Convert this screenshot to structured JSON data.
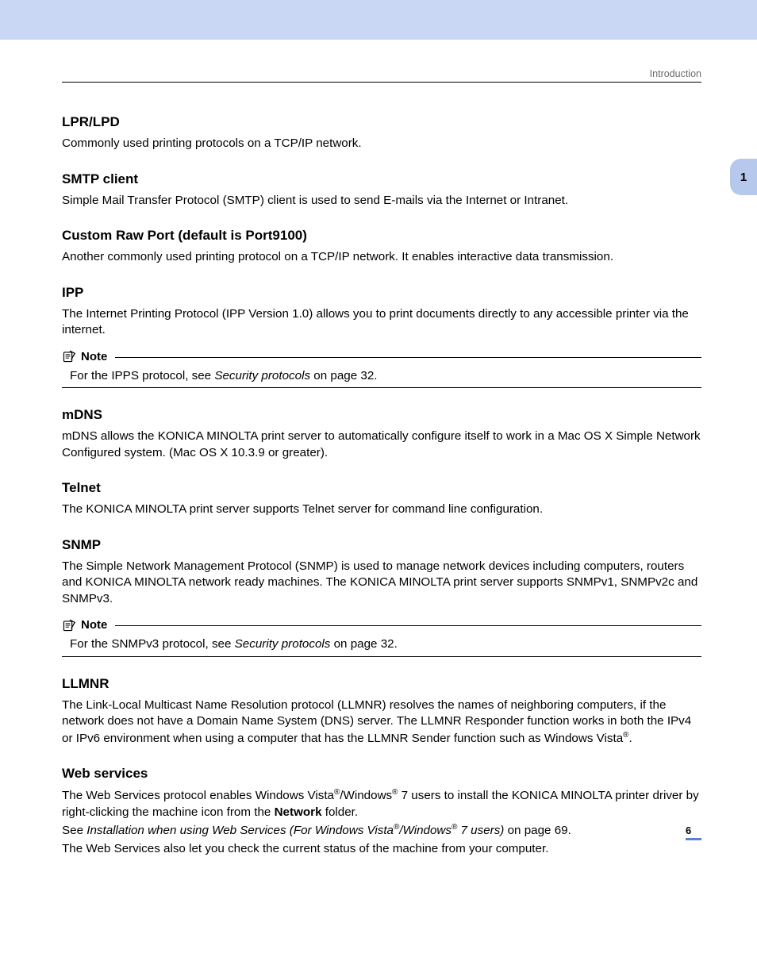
{
  "header": {
    "section_label": "Introduction"
  },
  "side_tab": {
    "chapter": "1"
  },
  "sections": {
    "lpr": {
      "title": "LPR/LPD",
      "body": "Commonly used printing protocols on a TCP/IP network."
    },
    "smtp": {
      "title": "SMTP client",
      "body": "Simple Mail Transfer Protocol (SMTP) client is used to send E-mails via the Internet or Intranet."
    },
    "rawport": {
      "title": "Custom Raw Port (default is Port9100)",
      "body": "Another commonly used printing protocol on a TCP/IP network. It enables interactive data transmission."
    },
    "ipp": {
      "title": "IPP",
      "body": "The Internet Printing Protocol (IPP Version 1.0) allows you to print documents directly to any accessible printer via the internet.",
      "note_label": "Note",
      "note_pre": "For the IPPS protocol, see ",
      "note_ital": "Security protocols",
      "note_post": " on page 32."
    },
    "mdns": {
      "title": "mDNS",
      "body": "mDNS allows the KONICA MINOLTA print server to automatically configure itself to work in a Mac OS X Simple Network Configured system. (Mac OS X 10.3.9 or greater)."
    },
    "telnet": {
      "title": "Telnet",
      "body": "The KONICA MINOLTA print server supports Telnet server for command line configuration."
    },
    "snmp": {
      "title": "SNMP",
      "body": "The Simple Network Management Protocol (SNMP) is used to manage network devices including computers, routers and KONICA MINOLTA network ready machines. The KONICA MINOLTA print server supports SNMPv1, SNMPv2c and SNMPv3.",
      "note_label": "Note",
      "note_pre": "For the SNMPv3 protocol, see ",
      "note_ital": "Security protocols",
      "note_post": " on page 32."
    },
    "llmnr": {
      "title": "LLMNR",
      "body_pre": "The Link-Local Multicast Name Resolution protocol (LLMNR) resolves the names of neighboring computers, if the network does not have a Domain Name System (DNS) server. The LLMNR Responder function works in both the IPv4 or IPv6 environment when using a computer that has the LLMNR Sender function such as Windows Vista",
      "body_post": "."
    },
    "webservices": {
      "title": "Web services",
      "p1_a": "The Web Services protocol enables Windows Vista",
      "p1_b": "/Windows",
      "p1_c": " 7 users to install the KONICA MINOLTA printer driver by right-clicking the machine icon from the ",
      "p1_bold": "Network",
      "p1_d": " folder.",
      "p2_a": "See ",
      "p2_ital_a": "Installation when using Web Services (For Windows Vista",
      "p2_ital_b": "/Windows",
      "p2_ital_c": " 7 users)",
      "p2_b": " on page 69.",
      "p3": "The Web Services also let you check the current status of the machine from your computer."
    }
  },
  "reg": "®",
  "page_number": "6"
}
